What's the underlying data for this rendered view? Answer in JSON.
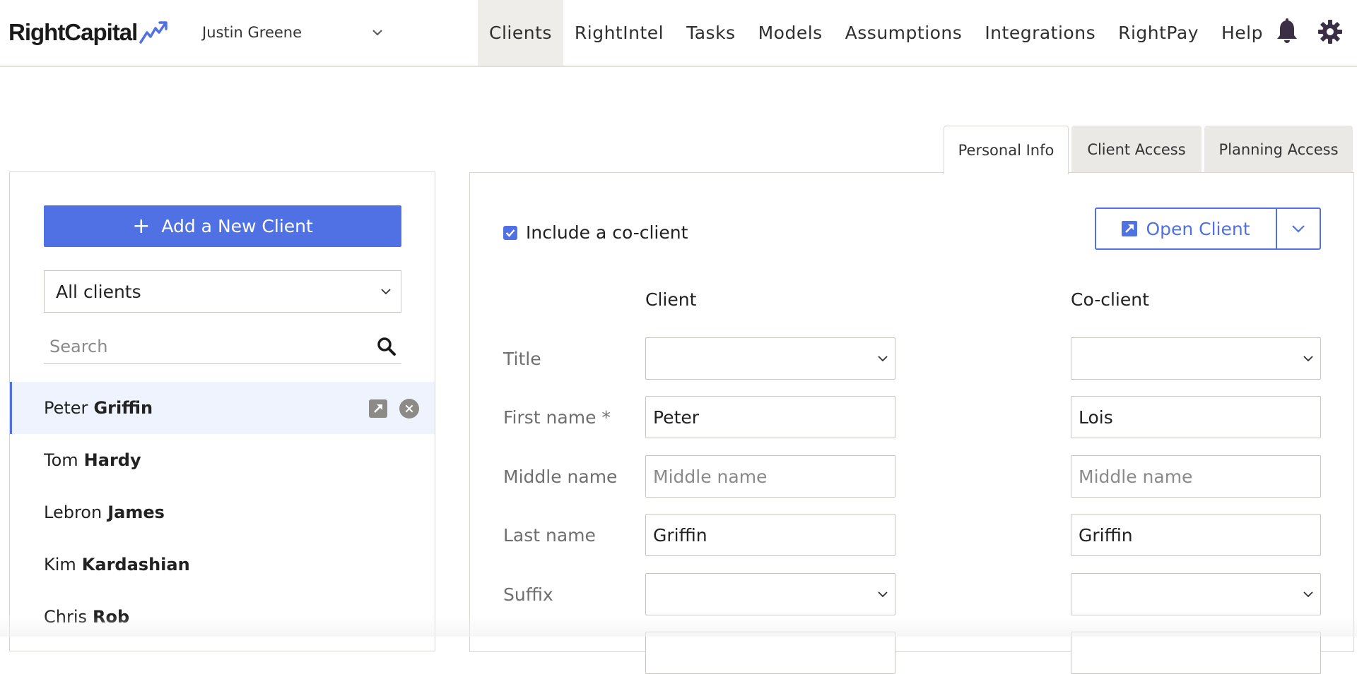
{
  "app": {
    "logo_text": "RightCapital",
    "user_name": "Justin Greene"
  },
  "nav": {
    "items": [
      "Clients",
      "RightIntel",
      "Tasks",
      "Models",
      "Assumptions",
      "Integrations",
      "RightPay",
      "Help"
    ],
    "active": "Clients",
    "icons": [
      "bell-icon",
      "gear-icon"
    ]
  },
  "tabs": {
    "items": [
      "Personal Info",
      "Client Access",
      "Planning Access"
    ],
    "active": "Personal Info"
  },
  "sidebar": {
    "add_label": "Add a New Client",
    "filter_value": "All clients",
    "search_placeholder": "Search",
    "clients": [
      {
        "first": "Peter",
        "last": "Griffin",
        "selected": true
      },
      {
        "first": "Tom",
        "last": "Hardy"
      },
      {
        "first": "Lebron",
        "last": "James"
      },
      {
        "first": "Kim",
        "last": "Kardashian"
      },
      {
        "first": "Chris",
        "last": "Rob"
      }
    ]
  },
  "form": {
    "include_coclient_label": "Include a co-client",
    "include_coclient_checked": true,
    "open_client_label": "Open Client",
    "client_header": "Client",
    "coclient_header": "Co-client",
    "labels": {
      "title": "Title",
      "first_name": "First name *",
      "middle_name": "Middle name",
      "last_name": "Last name",
      "suffix": "Suffix"
    },
    "client": {
      "title": "",
      "first_name": "Peter",
      "middle_name_placeholder": "Middle name",
      "last_name": "Griffin",
      "suffix": ""
    },
    "coclient": {
      "title": "",
      "first_name": "Lois",
      "middle_name_placeholder": "Middle name",
      "last_name": "Griffin",
      "suffix": ""
    }
  },
  "colors": {
    "accent": "#4f71e3",
    "nav_active_bg": "#efede9",
    "selected_row_bg": "#eef3fd"
  }
}
